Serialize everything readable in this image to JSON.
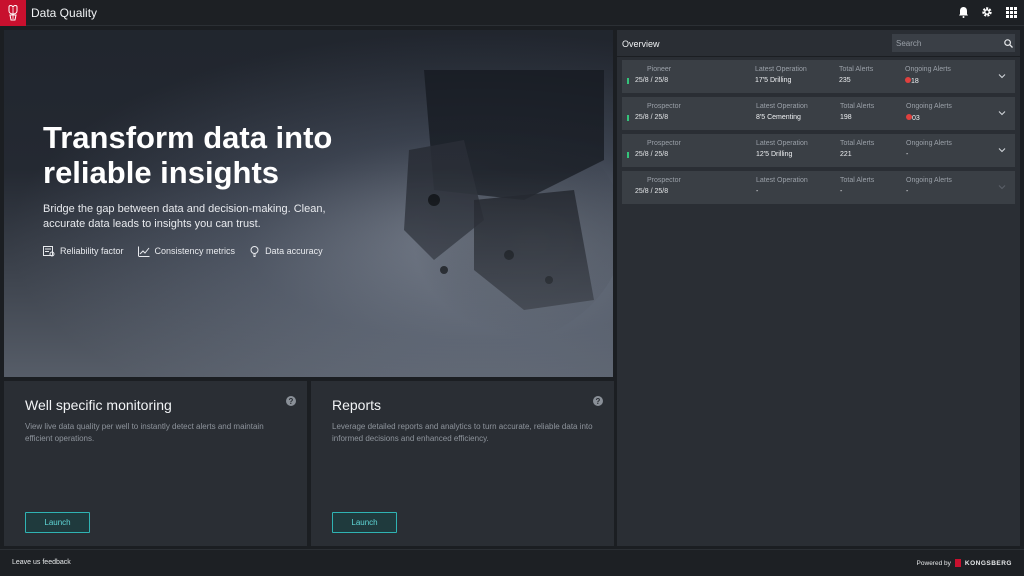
{
  "app": {
    "title": "Data Quality",
    "brand_color": "#c8102e",
    "accent_color": "#2fb3b3"
  },
  "topbar": {
    "icons": [
      "bell-icon",
      "gear-icon",
      "grid-icon"
    ]
  },
  "hero": {
    "title": "Transform data into reliable insights",
    "subtitle": "Bridge the gap between data and decision-making. Clean, accurate data leads to insights you can trust.",
    "features": [
      {
        "label": "Reliability factor",
        "icon": "reliability-icon"
      },
      {
        "label": "Consistency metrics",
        "icon": "chart-trend-icon"
      },
      {
        "label": "Data accuracy",
        "icon": "lightbulb-icon"
      }
    ]
  },
  "cards": [
    {
      "title": "Well specific monitoring",
      "description": "View live data quality per well to instantly detect alerts and maintain efficient operations.",
      "button": "Launch"
    },
    {
      "title": "Reports",
      "description": "Leverage detailed reports and analytics to turn accurate, reliable data into informed decisions and enhanced efficiency.",
      "button": "Launch"
    }
  ],
  "overview": {
    "title": "Overview",
    "search_placeholder": "Search",
    "columns": {
      "operation": "Latest Operation",
      "total": "Total Alerts",
      "ongoing": "Ongoing Alerts"
    },
    "wells": [
      {
        "name": "Pioneer",
        "dates": "25/8 / 25/8",
        "operation": "17'5 Drilling",
        "total": "235",
        "ongoing": "18",
        "alert": true
      },
      {
        "name": "Prospector",
        "dates": "25/8 / 25/8",
        "operation": "8'5 Cementing",
        "total": "198",
        "ongoing": "03",
        "alert": true
      },
      {
        "name": "Prospector",
        "dates": "25/8 / 25/8",
        "operation": "12'5 Drilling",
        "total": "221",
        "ongoing": "-",
        "alert": false
      },
      {
        "name": "Prospector",
        "dates": "25/8 / 25/8",
        "operation": "-",
        "total": "-",
        "ongoing": "-",
        "alert": false
      }
    ]
  },
  "footer": {
    "feedback": "Leave us feedback",
    "powered_by": "Powered by",
    "brand": "KONGSBERG"
  }
}
